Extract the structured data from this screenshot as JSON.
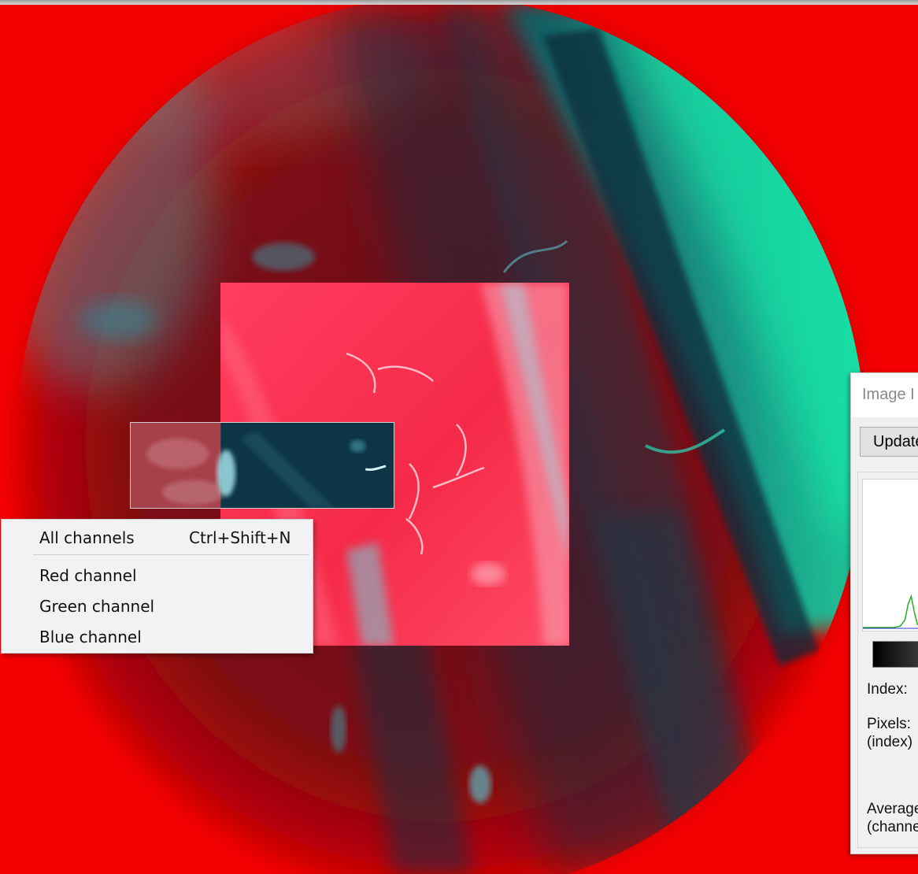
{
  "colors": {
    "background_red": "#f40000",
    "cyan_glow": "#12e6a8",
    "menu_background": "#f2f2f2",
    "dialog_background": "#f0f0f0"
  },
  "context_menu": {
    "items": [
      {
        "label": "All channels",
        "shortcut": "Ctrl+Shift+N"
      },
      {
        "label": "Red channel",
        "shortcut": ""
      },
      {
        "label": "Green channel",
        "shortcut": ""
      },
      {
        "label": "Blue channel",
        "shortcut": ""
      }
    ]
  },
  "histogram_dialog": {
    "title": "Image I",
    "update_label": "Update",
    "index_label": "Index:",
    "pixels_label": "Pixels:",
    "pixels_sublabel": "(index)",
    "average_label": "Average",
    "average_sublabel": "(channe"
  }
}
